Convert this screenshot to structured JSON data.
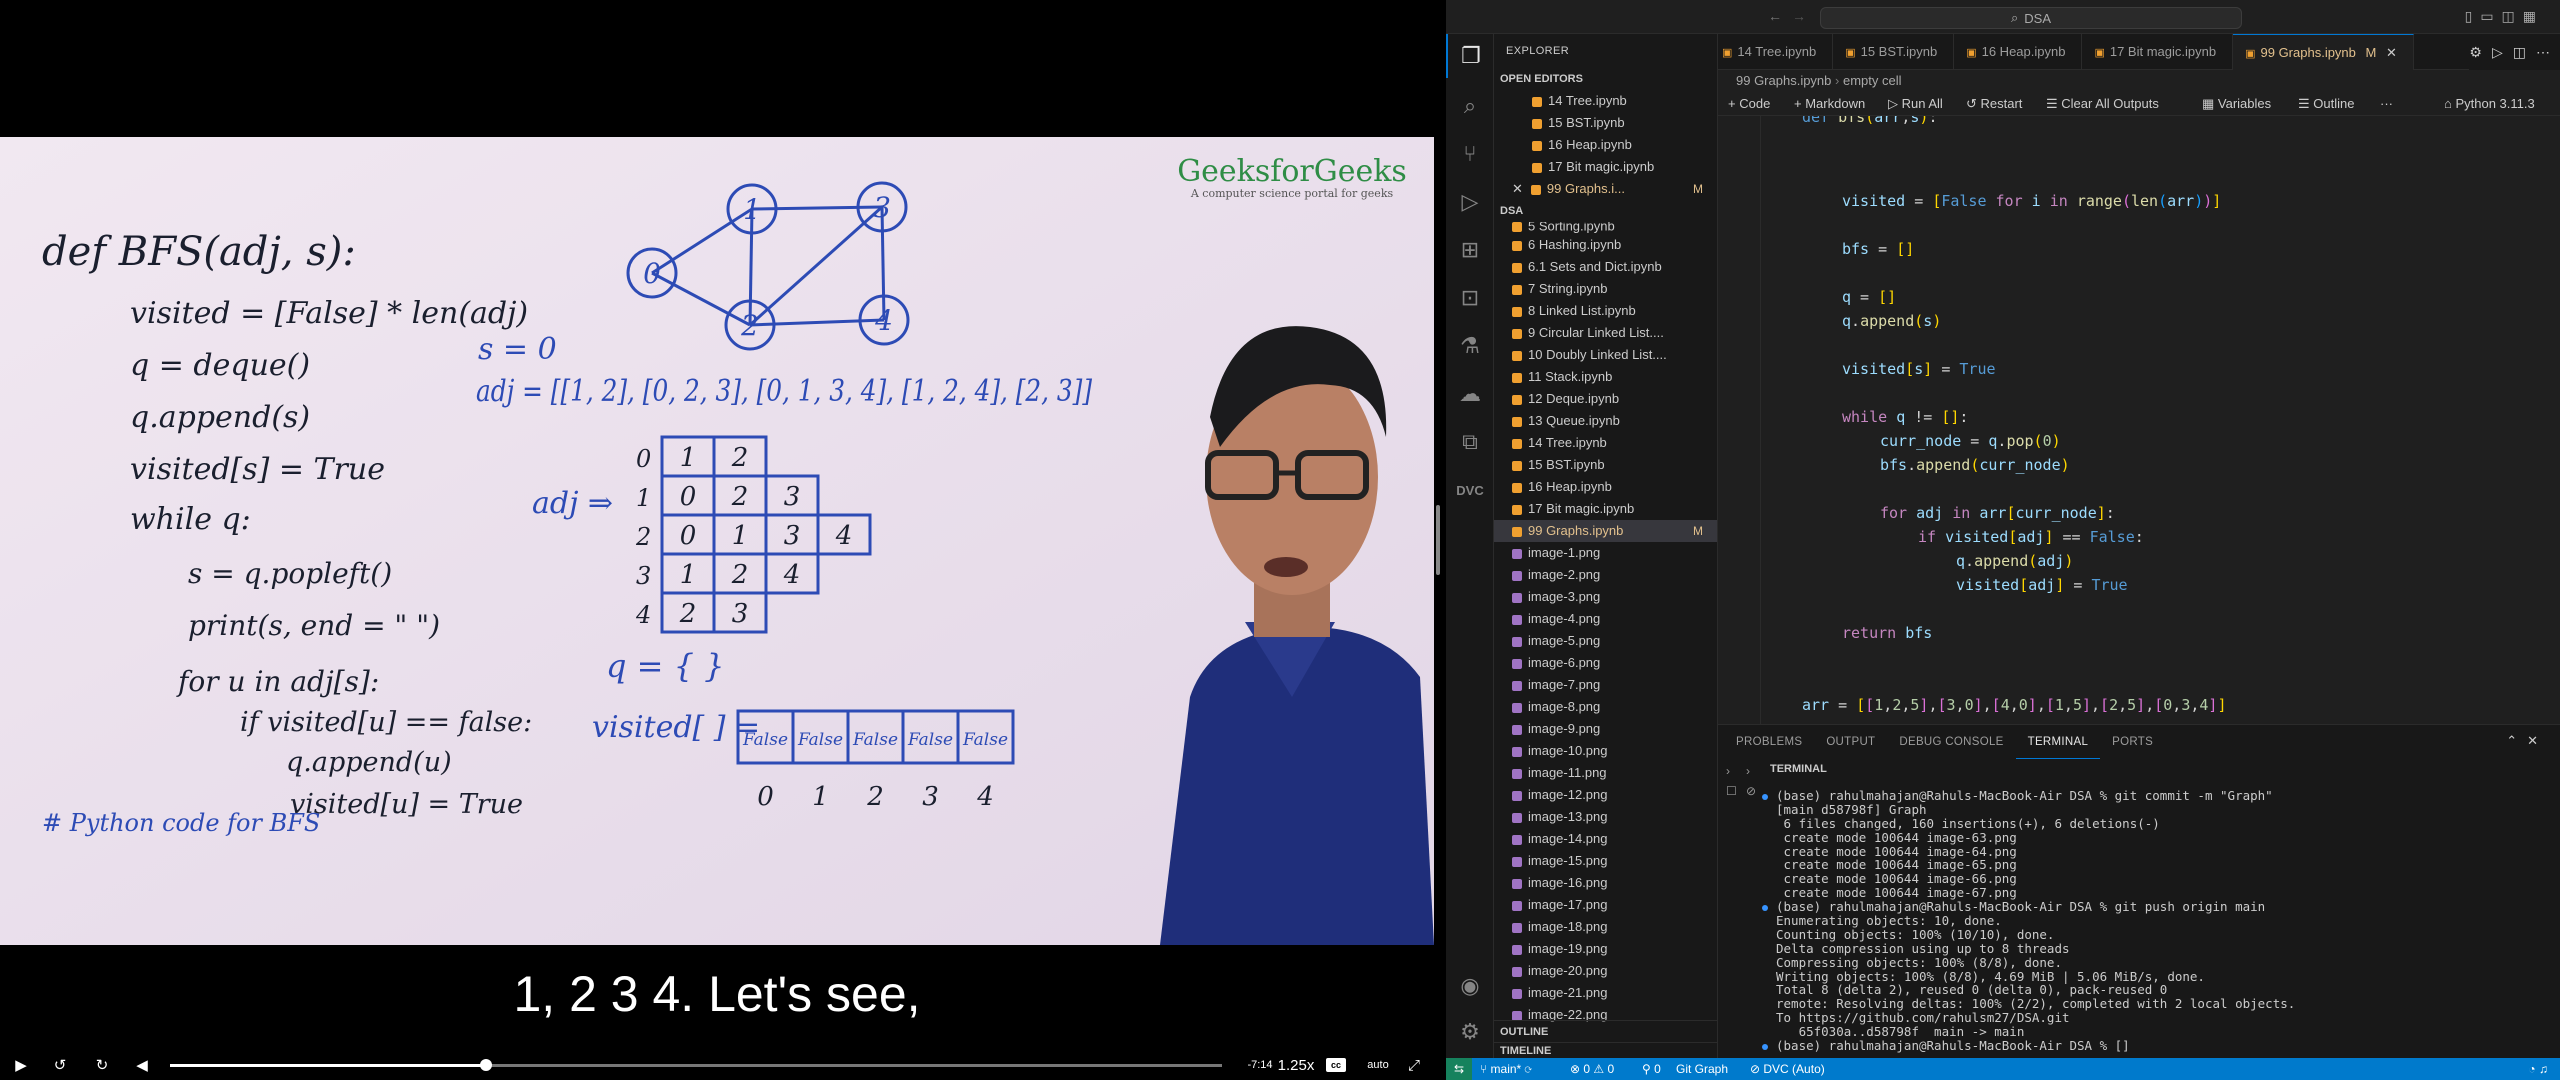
{
  "video": {
    "caption": "1, 2 3 4. Let's see,",
    "time_remaining": "-7:14",
    "speed": "1.25x",
    "cc_label": "cc",
    "quality": "auto",
    "progress": 0.3,
    "logo_title": "GeeksforGeeks",
    "logo_tagline": "A computer science portal for geeks",
    "whiteboard": {
      "code": [
        "def BFS(adj, s):",
        "visited = [False] * len(adj)",
        "q = deque()",
        "q.append(s)",
        "visited[s] = True",
        "while q:",
        "s = q.popleft()",
        "print(s, end = \" \")",
        "for u in adj[s]:",
        "if visited[u] == false:",
        "q.append(u)",
        "visited[u] = True",
        "# Python code for BFS"
      ],
      "graph_nodes": [
        "0",
        "1",
        "2",
        "3",
        "4"
      ],
      "s_line": "s = 0",
      "adj_line": "adj = [[1, 2], [0, 2, 3], [0, 1, 3, 4], [1, 2, 4], [2, 3]]",
      "adj_label": "adj ⇒",
      "adj_rows": [
        {
          "idx": "0",
          "cells": [
            "1",
            "2"
          ]
        },
        {
          "idx": "1",
          "cells": [
            "0",
            "2",
            "3"
          ]
        },
        {
          "idx": "2",
          "cells": [
            "0",
            "1",
            "3",
            "4"
          ]
        },
        {
          "idx": "3",
          "cells": [
            "1",
            "2",
            "4"
          ]
        },
        {
          "idx": "4",
          "cells": [
            "2",
            "3"
          ]
        }
      ],
      "q_line": "q = { }",
      "visited_label": "visited[ ] =",
      "visited_cells": [
        "False",
        "False",
        "False",
        "False",
        "False"
      ],
      "visited_idx": [
        "0",
        "1",
        "2",
        "3",
        "4"
      ]
    }
  },
  "vscode": {
    "search": "DSA",
    "explorer_title": "EXPLORER",
    "open_editors_title": "OPEN EDITORS",
    "open_editors": [
      "14 Tree.ipynb",
      "15 BST.ipynb",
      "16 Heap.ipynb",
      "17 Bit magic.ipynb",
      "99 Graphs.i..."
    ],
    "dsa_title": "DSA",
    "files": [
      "5 Sorting.ipynb",
      "6 Hashing.ipynb",
      "6.1 Sets and Dict.ipynb",
      "7 String.ipynb",
      "8 Linked List.ipynb",
      "9 Circular Linked List....",
      "10 Doubly Linked List....",
      "11 Stack.ipynb",
      "12 Deque.ipynb",
      "13 Queue.ipynb",
      "14 Tree.ipynb",
      "15 BST.ipynb",
      "16 Heap.ipynb",
      "17 Bit magic.ipynb",
      "99 Graphs.ipynb",
      "image-1.png",
      "image-2.png",
      "image-3.png",
      "image-4.png",
      "image-5.png",
      "image-6.png",
      "image-7.png",
      "image-8.png",
      "image-9.png",
      "image-10.png",
      "image-11.png",
      "image-12.png",
      "image-13.png",
      "image-14.png",
      "image-15.png",
      "image-16.png",
      "image-17.png",
      "image-18.png",
      "image-19.png",
      "image-20.png",
      "image-21.png",
      "image-22.png"
    ],
    "modified_mark": "M",
    "outline_title": "OUTLINE",
    "timeline_title": "TIMELINE",
    "tabs": [
      "14 Tree.ipynb",
      "15 BST.ipynb",
      "16 Heap.ipynb",
      "17 Bit magic.ipynb",
      "99 Graphs.ipynb"
    ],
    "breadcrumb": [
      "99 Graphs.ipynb",
      "empty cell"
    ],
    "toolbar": {
      "code": "Code",
      "markdown": "Markdown",
      "run_all": "Run All",
      "restart": "Restart",
      "clear": "Clear All Outputs",
      "variables": "Variables",
      "outline": "Outline",
      "more": "···",
      "kernel": "Python 3.11.3"
    },
    "panel_tabs": [
      "PROBLEMS",
      "OUTPUT",
      "DEBUG CONSOLE",
      "TERMINAL",
      "PORTS"
    ],
    "terminal_title": "TERMINAL",
    "terminal": [
      "(base) rahulmahajan@Rahuls-MacBook-Air DSA % git commit -m \"Graph\"",
      "[main d58798f] Graph",
      " 6 files changed, 160 insertions(+), 6 deletions(-)",
      " create mode 100644 image-63.png",
      " create mode 100644 image-64.png",
      " create mode 100644 image-65.png",
      " create mode 100644 image-66.png",
      " create mode 100644 image-67.png",
      "(base) rahulmahajan@Rahuls-MacBook-Air DSA % git push origin main",
      "Enumerating objects: 10, done.",
      "Counting objects: 100% (10/10), done.",
      "Delta compression using up to 8 threads",
      "Compressing objects: 100% (8/8), done.",
      "Writing objects: 100% (8/8), 4.69 MiB | 5.06 MiB/s, done.",
      "Total 8 (delta 2), reused 0 (delta 0), pack-reused 0",
      "remote: Resolving deltas: 100% (2/2), completed with 2 local objects.",
      "To https://github.com/rahulsm27/DSA.git",
      "   65f030a..d58798f  main -> main",
      "(base) rahulmahajan@Rahuls-MacBook-Air DSA % []"
    ],
    "status": {
      "branch": "main*",
      "errors": "0",
      "warnings": "0",
      "ports": "0",
      "git_graph": "Git Graph",
      "dvc": "DVC (Auto)"
    }
  }
}
